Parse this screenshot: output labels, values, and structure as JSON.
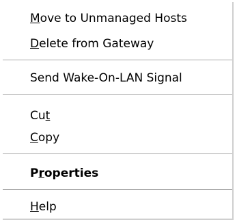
{
  "menu": {
    "items": [
      {
        "pre": "",
        "key": "M",
        "post": "ove to Unmanaged Hosts"
      },
      {
        "pre": "",
        "key": "D",
        "post": "elete from Gateway"
      },
      {
        "pre": "Send Wake-On-LAN Signal",
        "key": "",
        "post": ""
      },
      {
        "pre": "Cu",
        "key": "t",
        "post": ""
      },
      {
        "pre": "",
        "key": "C",
        "post": "opy"
      },
      {
        "pre": "P",
        "key": "r",
        "post": "operties"
      },
      {
        "pre": "",
        "key": "H",
        "post": "elp"
      }
    ]
  }
}
